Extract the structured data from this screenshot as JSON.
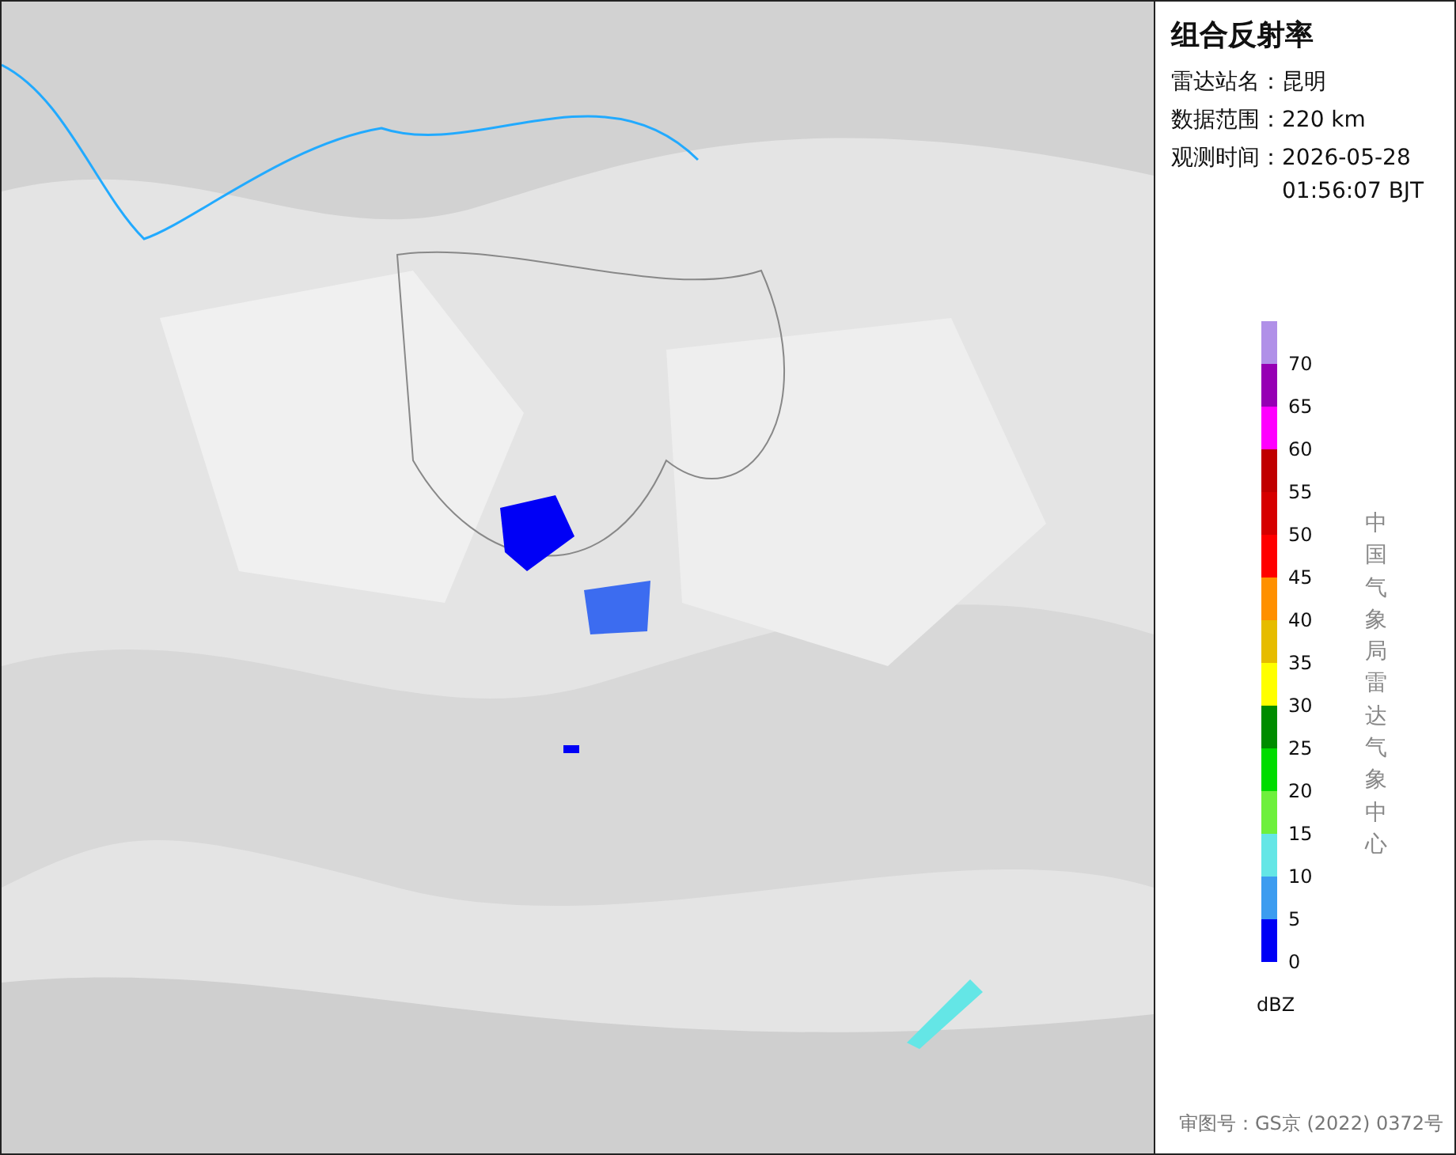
{
  "panel": {
    "title": "组合反射率",
    "fields": [
      {
        "label": "雷达站名：",
        "value": "昆明"
      },
      {
        "label": "数据范围：",
        "value": "220 km"
      },
      {
        "label": "观测时间：",
        "value": "2026-05-28\n01:56:07 BJT"
      }
    ]
  },
  "legend": [
    {
      "color": "#b090e8",
      "label": "70"
    },
    {
      "color": "#9600b4",
      "label": "65"
    },
    {
      "color": "#ff00ff",
      "label": "60"
    },
    {
      "color": "#c00000",
      "label": "55"
    },
    {
      "color": "#d60000",
      "label": "50"
    },
    {
      "color": "#ff0000",
      "label": "45"
    },
    {
      "color": "#ff9000",
      "label": "40"
    },
    {
      "color": "#e6bc00",
      "label": "35"
    },
    {
      "color": "#ffff00",
      "label": "30"
    },
    {
      "color": "#008c00",
      "label": "25"
    },
    {
      "color": "#00dc00",
      "label": "20"
    },
    {
      "color": "#6ef03c",
      "label": "15"
    },
    {
      "color": "#64e6e6",
      "label": "10"
    },
    {
      "color": "#3c9cf0",
      "label": "5"
    },
    {
      "color": "#0000f6",
      "label": "0"
    }
  ],
  "legend_unit": "dBZ",
  "credit": "中国气象局雷达气象中心",
  "approval": "审图号：GS京 (2022) 0372号"
}
